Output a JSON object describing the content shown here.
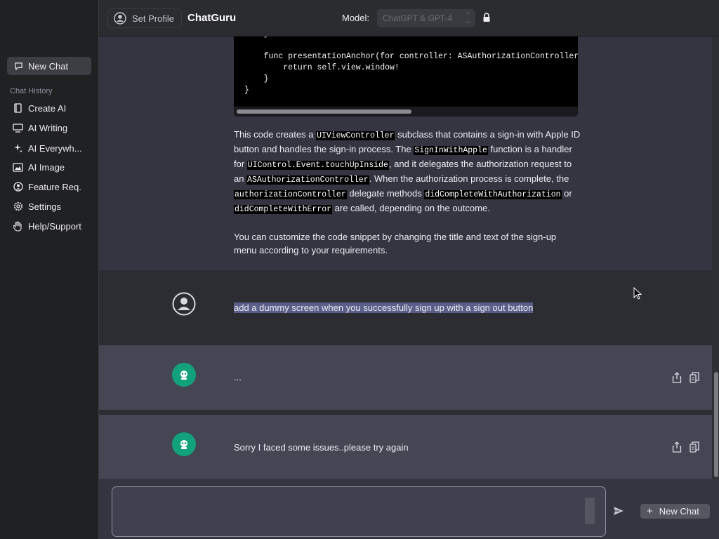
{
  "sidebar": {
    "new_chat": "New Chat",
    "history_title": "Chat History",
    "items": [
      {
        "label": "Create AI",
        "icon": "book-icon"
      },
      {
        "label": "AI Writing",
        "icon": "monitor-icon"
      },
      {
        "label": "AI Everywh...",
        "icon": "sparkle-icon"
      },
      {
        "label": "AI Image",
        "icon": "image-icon"
      },
      {
        "label": "Feature Req.",
        "icon": "person-circle-icon"
      },
      {
        "label": "Settings",
        "icon": "gear-icon"
      },
      {
        "label": "Help/Support",
        "icon": "hand-icon"
      }
    ]
  },
  "header": {
    "set_profile": "Set Profile",
    "title": "ChatGuru",
    "model_label": "Model:",
    "model_value": "ChatGPT & GPT-4"
  },
  "code": {
    "lines": [
      "    }",
      "    func presentationAnchor(for controller: ASAuthorizationController)",
      "        return self.view.window!",
      "    }",
      "}"
    ]
  },
  "messages": {
    "para1": {
      "t1": "This code creates a ",
      "c1": "UIViewController",
      "t2": " subclass that contains a sign-in with Apple ID button and handles the sign-in process. The ",
      "c2": "SignInWithApple",
      "t3": " function is a handler for ",
      "c3": "UIControl.Event.touchUpInside",
      "t4": ", and it delegates the authorization request to an ",
      "c4": "ASAuthorizationController",
      "t5": ". When the authorization process is complete, the ",
      "c5": "authorizationController",
      "t6": " delegate methods ",
      "c6": "didCompleteWithAuthorization",
      "t7": " or ",
      "c7": "didCompleteWithError",
      "t8": " are called, depending on the outcome."
    },
    "para2": "You can customize the code snippet by changing the title and text of the sign-up menu according to your requirements.",
    "user_message": "add a dummy screen when you successfully sign up with a sign out button",
    "ai_pending": "...",
    "ai_error": "Sorry I faced some issues..please try again"
  },
  "input": {
    "value": "",
    "placeholder": ""
  },
  "bottom": {
    "new_chat": "New Chat"
  },
  "colors": {
    "bot_avatar": "#12a27b",
    "selection": "#5a5f8a",
    "sidebar_bg": "#202123",
    "main_bg": "#343541"
  }
}
